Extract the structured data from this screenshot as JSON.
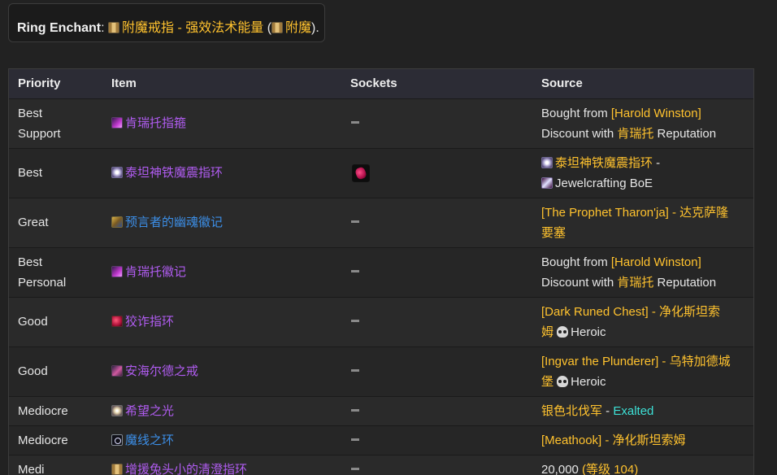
{
  "enchant": {
    "label": "Ring Enchant",
    "colon": ":",
    "name": "附魔戒指 - 强效法术能量",
    "paren_open": "(",
    "profession": "附魔",
    "paren_close": ")."
  },
  "table": {
    "headers": [
      "Priority",
      "Item",
      "Sockets",
      "Source"
    ],
    "rows": [
      {
        "priority": "Best Support",
        "priority_lines": [
          "Best",
          "Support"
        ],
        "item": "肯瑞托指箍",
        "item_color": "purple",
        "icon": "bracer-icon",
        "sockets": "none",
        "source_lines": [
          [
            {
              "t": "Bought from ",
              "c": ""
            },
            {
              "t": "[Harold Winston]",
              "c": "gold"
            }
          ],
          [
            {
              "t": "Discount with ",
              "c": ""
            },
            {
              "t": "肯瑞托",
              "c": "gold"
            },
            {
              "t": " Reputation",
              "c": ""
            }
          ]
        ]
      },
      {
        "priority": "Best",
        "priority_lines": [
          "Best"
        ],
        "item": "泰坦神铁魔震指环",
        "item_color": "purple",
        "icon": "ring-icon",
        "sockets": "red-gem",
        "source_lines": [
          [
            {
              "icon": "ring-icon"
            },
            {
              "t": "泰坦神铁魔震指环",
              "c": "gold"
            },
            {
              "t": " -",
              "c": ""
            }
          ],
          [
            {
              "icon": "gem-icon"
            },
            {
              "t": "Jewelcrafting BoE",
              "c": ""
            }
          ]
        ]
      },
      {
        "priority": "Great",
        "priority_lines": [
          "Great"
        ],
        "item": "预言者的幽魂徽记",
        "item_color": "blue",
        "icon": "book-icon",
        "sockets": "none",
        "source_lines": [
          [
            {
              "t": "[The Prophet Tharon'ja] - 达克萨隆",
              "c": "gold"
            }
          ],
          [
            {
              "t": "要塞",
              "c": "gold"
            }
          ]
        ]
      },
      {
        "priority": "Best Personal",
        "priority_lines": [
          "Best",
          "Personal"
        ],
        "item": "肯瑞托徽记",
        "item_color": "purple",
        "icon": "bracer-icon",
        "sockets": "none",
        "source_lines": [
          [
            {
              "t": "Bought from ",
              "c": ""
            },
            {
              "t": "[Harold Winston]",
              "c": "gold"
            }
          ],
          [
            {
              "t": "Discount with ",
              "c": ""
            },
            {
              "t": "肯瑞托",
              "c": "gold"
            },
            {
              "t": " Reputation",
              "c": ""
            }
          ]
        ]
      },
      {
        "priority": "Good",
        "priority_lines": [
          "Good"
        ],
        "item": "狡诈指环",
        "item_color": "purple",
        "icon": "red-ring-icon",
        "sockets": "none",
        "source_lines": [
          [
            {
              "t": "[Dark Runed Chest] - 净化斯坦索",
              "c": "gold"
            }
          ],
          [
            {
              "t": "姆 ",
              "c": "gold"
            },
            {
              "skull": true
            },
            {
              "t": "Heroic",
              "c": ""
            }
          ]
        ]
      },
      {
        "priority": "Good",
        "priority_lines": [
          "Good"
        ],
        "item": "安海尔德之戒",
        "item_color": "purple",
        "icon": "sword-icon",
        "sockets": "none",
        "source_lines": [
          [
            {
              "t": "[Ingvar the Plunderer] - 乌特加德城",
              "c": "gold"
            }
          ],
          [
            {
              "t": "堡 ",
              "c": "gold"
            },
            {
              "skull": true
            },
            {
              "t": "Heroic",
              "c": ""
            }
          ]
        ]
      },
      {
        "priority": "Mediocre",
        "priority_lines": [
          "Mediocre"
        ],
        "item": "希望之光",
        "item_color": "purple",
        "icon": "orb-icon",
        "sockets": "none",
        "source_lines": [
          [
            {
              "t": "银色北伐军",
              "c": "gold"
            },
            {
              "t": " - ",
              "c": ""
            },
            {
              "t": "Exalted",
              "c": "teal"
            }
          ]
        ]
      },
      {
        "priority": "Mediocre",
        "priority_lines": [
          "Mediocre"
        ],
        "item": "魔线之环",
        "item_color": "blue",
        "icon": "loop-icon",
        "sockets": "none",
        "source_lines": [
          [
            {
              "t": "[Meathook] - 净化斯坦索姆",
              "c": "gold"
            }
          ]
        ]
      },
      {
        "priority": "Medi",
        "priority_lines": [
          "Medi"
        ],
        "item": "增援兔头小的清澄指环",
        "item_color": "purple",
        "icon": "scroll-icon",
        "sockets": "none",
        "source_lines": [
          [
            {
              "t": "20,000 ",
              "c": ""
            },
            {
              "t": "(等级 104)",
              "c": "gold"
            }
          ]
        ]
      }
    ]
  },
  "colors": {
    "gold": "#ffc22e",
    "purple": "#b05cf0",
    "blue": "#3c8ee6",
    "teal": "#3de0d6"
  }
}
